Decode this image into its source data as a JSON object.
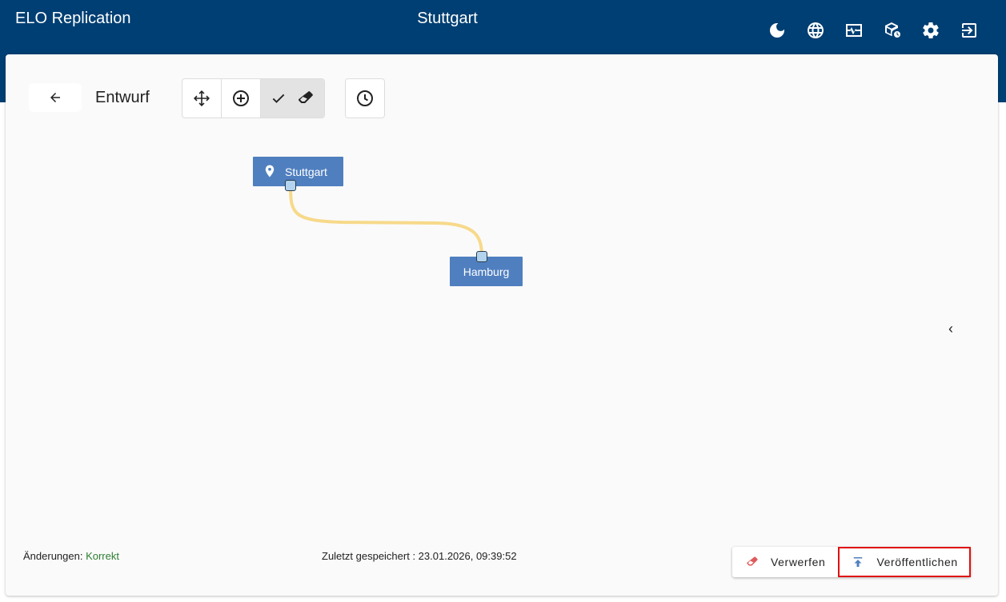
{
  "header": {
    "app_title": "ELO Replication",
    "location_title": "Stuttgart",
    "icons": [
      "moon-icon",
      "globe-icon",
      "monitor-heartbeat-icon",
      "package-clock-icon",
      "gear-icon",
      "logout-icon"
    ]
  },
  "toolbar": {
    "mode_label": "Entwurf",
    "tools": [
      "move-icon",
      "add-circle-icon",
      "check-icon",
      "eraser-icon"
    ],
    "history_icon": "clock-icon"
  },
  "graph": {
    "nodes": [
      {
        "label": "Stuttgart",
        "icon": "location-pin-icon"
      },
      {
        "label": "Hamburg"
      }
    ],
    "edge_color": "#f7d98a",
    "node_color": "#4f7fbf"
  },
  "status": {
    "changes_label": "Änderungen:",
    "changes_value": "Korrekt",
    "saved_text": "Zuletzt gespeichert : 23.01.2026, 09:39:52"
  },
  "actions": {
    "discard_label": "Verwerfen",
    "publish_label": "Veröffentlichen"
  },
  "colors": {
    "appbar": "#003f73",
    "ok": "#2e7d32",
    "highlight": "#e01010"
  }
}
